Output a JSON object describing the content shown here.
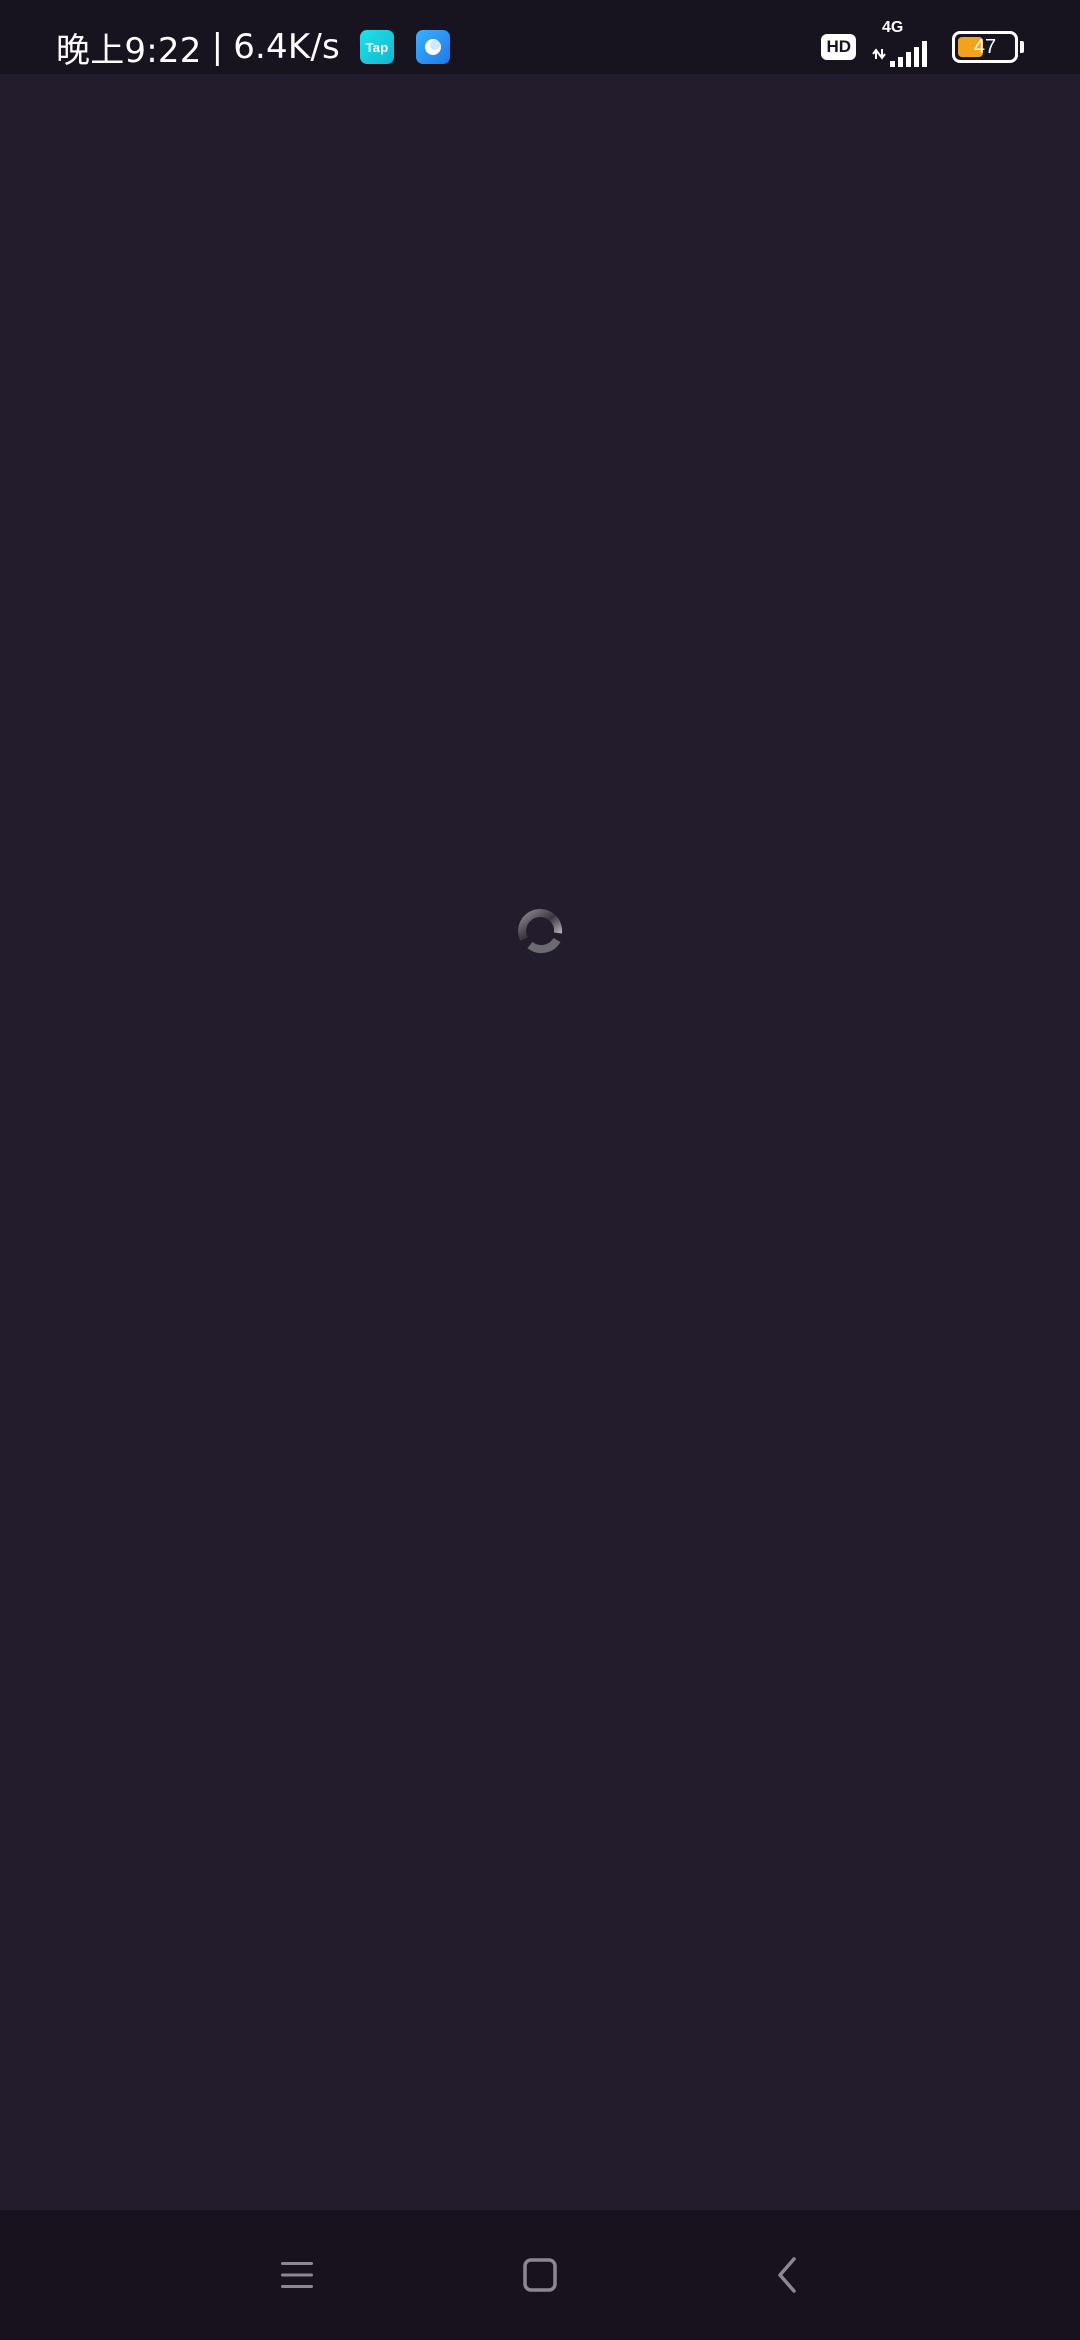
{
  "status_bar": {
    "time": "晚上9:22",
    "separator": "|",
    "net_speed": "6.4K/s",
    "notification_icons": [
      "taptap-app-icon",
      "chat-bubble-app-icon"
    ],
    "tap_icon_label": "Tap",
    "hd_label": "HD",
    "network_type": "4G",
    "battery_level": "47",
    "battery_fraction": 0.47,
    "battery_color": "#f0a31b"
  },
  "content": {
    "state": "loading",
    "spinner_icon": "loading-spinner-icon"
  },
  "nav_bar": {
    "buttons": [
      "menu-icon",
      "home-icon",
      "back-icon"
    ]
  },
  "colors": {
    "background": "#231c2c",
    "status_bar_bg": "#17131f",
    "nav_bar_bg": "#17121d"
  }
}
